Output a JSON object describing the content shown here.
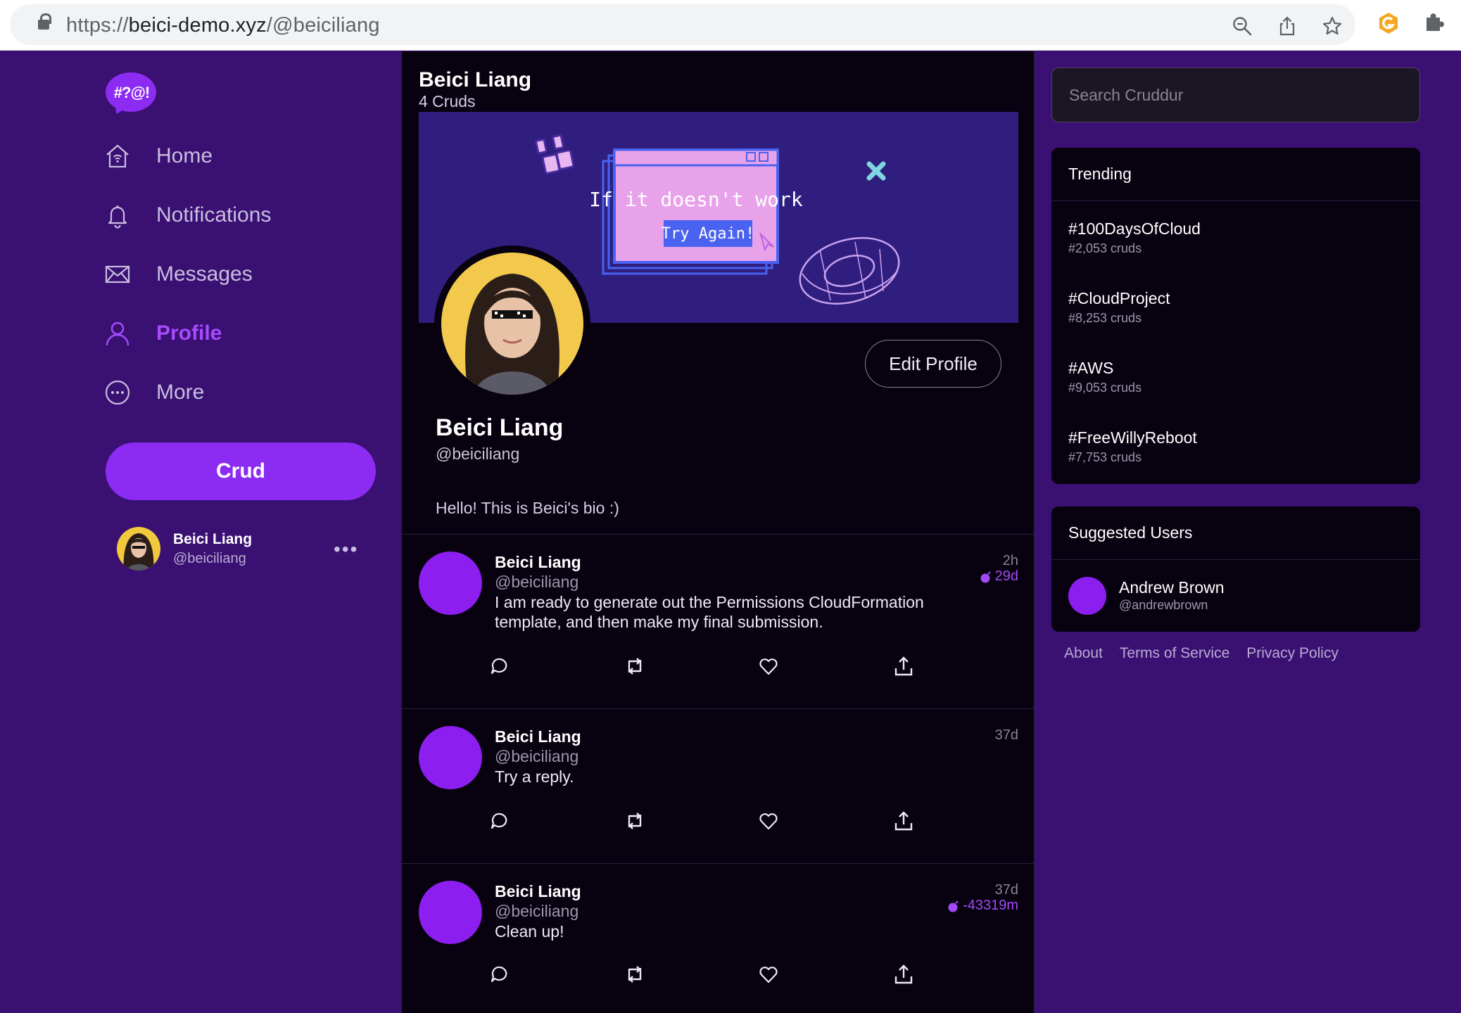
{
  "browser": {
    "url_scheme": "https://",
    "url_host": "beici-demo.xyz",
    "url_path": "/@beiciliang",
    "icons": [
      "lock-icon",
      "zoom-icon",
      "share-icon",
      "star-icon",
      "extension-g-icon",
      "puzzle-icon"
    ]
  },
  "app": {
    "logo_text": "#?@!",
    "accent_color": "#8c2bf2",
    "sidebar_bg": "#3a1172",
    "main_bg": "#08010f"
  },
  "nav": {
    "items": [
      {
        "label": "Home",
        "icon": "home-icon"
      },
      {
        "label": "Notifications",
        "icon": "bell-icon"
      },
      {
        "label": "Messages",
        "icon": "mail-icon"
      },
      {
        "label": "Profile",
        "icon": "user-icon",
        "active": true
      },
      {
        "label": "More",
        "icon": "more-circle-icon"
      }
    ],
    "crud_button": "Crud",
    "user": {
      "name": "Beici Liang",
      "handle": "@beiciliang",
      "more": "•••"
    }
  },
  "profile": {
    "header_name": "Beici Liang",
    "crud_count": "4 Cruds",
    "banner_text_1": "If it doesn't work",
    "banner_text_2": "Try Again!",
    "edit_button": "Edit Profile",
    "name": "Beici Liang",
    "handle": "@beiciliang",
    "bio": "Hello! This is Beici's bio :)"
  },
  "posts": [
    {
      "name": "Beici Liang",
      "handle": "@beiciliang",
      "time": "2h",
      "bomb": "29d",
      "text": "I am ready to generate out the Permissions CloudFormation template, and then make my final submission."
    },
    {
      "name": "Beici Liang",
      "handle": "@beiciliang",
      "time": "37d",
      "bomb": "",
      "text": "Try a reply."
    },
    {
      "name": "Beici Liang",
      "handle": "@beiciliang",
      "time": "37d",
      "bomb": "-43319m",
      "text": "Clean up!"
    }
  ],
  "right": {
    "search_placeholder": "Search Cruddur",
    "trending_title": "Trending",
    "trends": [
      {
        "tag": "#100DaysOfCloud",
        "count": "#2,053 cruds"
      },
      {
        "tag": "#CloudProject",
        "count": "#8,253 cruds"
      },
      {
        "tag": "#AWS",
        "count": "#9,053 cruds"
      },
      {
        "tag": "#FreeWillyReboot",
        "count": "#7,753 cruds"
      }
    ],
    "suggested_title": "Suggested Users",
    "suggested": [
      {
        "name": "Andrew Brown",
        "handle": "@andrewbrown"
      }
    ],
    "footer": [
      "About",
      "Terms of Service",
      "Privacy Policy"
    ]
  }
}
